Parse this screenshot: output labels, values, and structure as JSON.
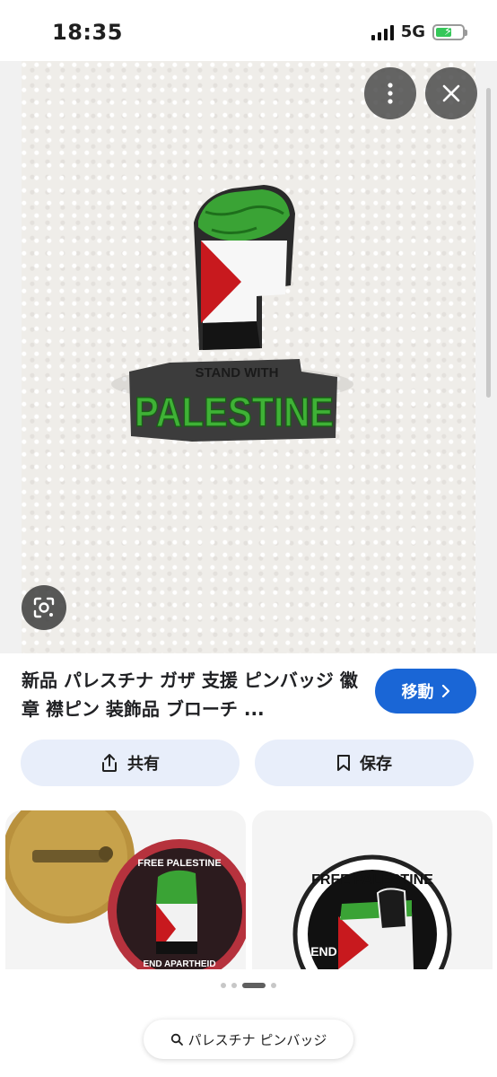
{
  "status": {
    "time": "18:35",
    "network": "5G"
  },
  "photo": {
    "pin_top_text": "STAND WITH",
    "pin_main_text": "PALESTINE"
  },
  "result": {
    "title": "新品 パレスチナ ガザ 支援 ピンバッジ 徽章 襟ピン 装飾品 ブローチ ...",
    "visit_label": "移動",
    "share_label": "共有",
    "save_label": "保存"
  },
  "related": [
    {
      "badge_top": "FREE PALESTINE",
      "badge_bottom": "END APARTHEID"
    },
    {
      "badge_top": "FREE PALESTINE",
      "badge_bottom": "END"
    }
  ],
  "search": {
    "query": "パレスチナ ピンバッジ"
  },
  "colors": {
    "accent": "#1a66d6",
    "pill_bg": "#e8eefa",
    "flag_green": "#3aa335",
    "flag_red": "#c8191e"
  }
}
